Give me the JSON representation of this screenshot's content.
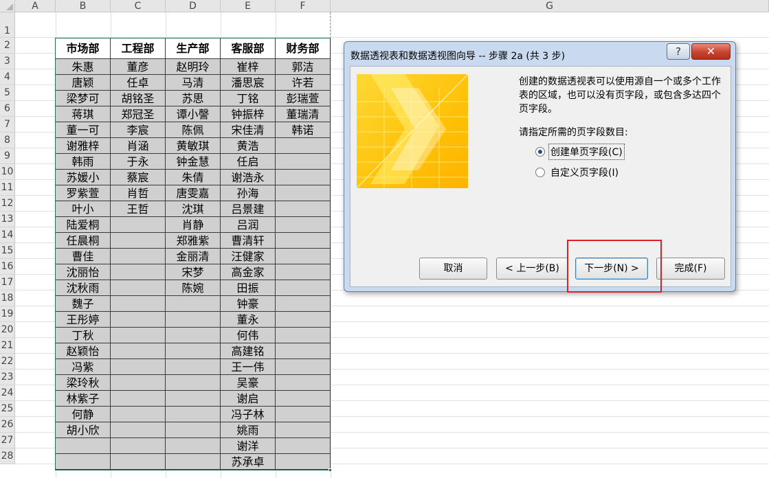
{
  "sheet": {
    "col_letters": [
      "A",
      "B",
      "C",
      "D",
      "E",
      "F",
      "G"
    ],
    "row_numbers": [
      "1",
      "2",
      "3",
      "4",
      "5",
      "6",
      "7",
      "8",
      "9",
      "10",
      "11",
      "12",
      "13",
      "14",
      "15",
      "16",
      "17",
      "18",
      "19",
      "20",
      "21",
      "22",
      "23",
      "24",
      "25",
      "26",
      "27",
      "28"
    ],
    "table": {
      "headers": [
        "市场部",
        "工程部",
        "生产部",
        "客服部",
        "财务部"
      ],
      "rows": [
        [
          "朱惠",
          "董彦",
          "赵明玲",
          "崔梓",
          "郭洁"
        ],
        [
          "唐颖",
          "任卓",
          "马清",
          "潘思宸",
          "许若"
        ],
        [
          "梁梦可",
          "胡铭圣",
          "苏思",
          "丁铭",
          "彭瑞萱"
        ],
        [
          "蒋琪",
          "郑冠圣",
          "谭小謦",
          "钟振梓",
          "董瑞清"
        ],
        [
          "董一可",
          "李宸",
          "陈佩",
          "宋佳清",
          "韩诺"
        ],
        [
          "谢雅梓",
          "肖涵",
          "黄敏琪",
          "黄浩",
          ""
        ],
        [
          "韩雨",
          "于永",
          "钟金慧",
          "任启",
          ""
        ],
        [
          "苏媛小",
          "蔡宸",
          "朱倩",
          "谢浩永",
          ""
        ],
        [
          "罗紫萱",
          "肖哲",
          "唐雯嘉",
          "孙海",
          ""
        ],
        [
          "叶小",
          "王哲",
          "沈琪",
          "吕景建",
          ""
        ],
        [
          "陆爱桐",
          "",
          "肖静",
          "吕润",
          ""
        ],
        [
          "任晨桐",
          "",
          "郑雅紫",
          "曹清轩",
          ""
        ],
        [
          "曹佳",
          "",
          "金丽清",
          "汪健家",
          ""
        ],
        [
          "沈丽怡",
          "",
          "宋梦",
          "高金家",
          ""
        ],
        [
          "沈秋雨",
          "",
          "陈婉",
          "田振",
          ""
        ],
        [
          "魏子",
          "",
          "",
          "钟豪",
          ""
        ],
        [
          "王彤婷",
          "",
          "",
          "董永",
          ""
        ],
        [
          "丁秋",
          "",
          "",
          "何伟",
          ""
        ],
        [
          "赵颖怡",
          "",
          "",
          "高建铭",
          ""
        ],
        [
          "冯紫",
          "",
          "",
          "王一伟",
          ""
        ],
        [
          "梁玲秋",
          "",
          "",
          "吴豪",
          ""
        ],
        [
          "林紫子",
          "",
          "",
          "谢启",
          ""
        ],
        [
          "何静",
          "",
          "",
          "冯子林",
          ""
        ],
        [
          "胡小欣",
          "",
          "",
          "姚雨",
          ""
        ],
        [
          "",
          "",
          "",
          "谢洋",
          ""
        ],
        [
          "",
          "",
          "",
          "苏承卓",
          ""
        ]
      ]
    }
  },
  "dialog": {
    "title": "数据透视表和数据透视图向导 -- 步骤 2a (共 3 步)",
    "help_label": "?",
    "close_label": "✕",
    "description": "创建的数据透视表可以使用源自一个或多个工作表的区域，也可以没有页字段，或包含多达四个页字段。",
    "prompt": "请指定所需的页字段数目:",
    "options": [
      {
        "label": "创建单页字段(C)",
        "selected": true
      },
      {
        "label": "自定义页字段(I)",
        "selected": false
      }
    ],
    "buttons": {
      "cancel": "取消",
      "back": "< 上一步(B)",
      "next": "下一步(N) >",
      "finish": "完成(F)"
    },
    "highlight_color": "#e02020",
    "wizard_image_colors": [
      "#fdd835",
      "#ffb300",
      "#fff176"
    ]
  }
}
